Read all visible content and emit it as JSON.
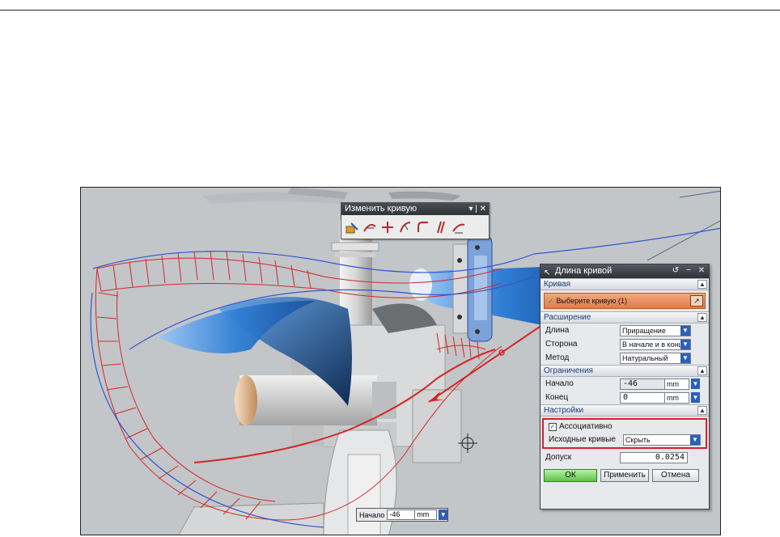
{
  "toolbar": {
    "title": "Изменить кривую",
    "icons": [
      "edit-curve-params-icon",
      "trim-curve-icon",
      "trim-corner-icon",
      "divide-curve-icon",
      "edit-fillet-icon",
      "stretch-curve-icon",
      "curve-length-icon",
      "smooth-spline-icon"
    ]
  },
  "dialog": {
    "title": "Длина кривой",
    "sections": {
      "curve": {
        "header": "Кривая",
        "select_label": "Выберите кривую (1)"
      },
      "extension": {
        "header": "Расширение",
        "length_label": "Длина",
        "length_value": "Приращение",
        "side_label": "Сторона",
        "side_value": "В начале и в конце",
        "method_label": "Метод",
        "method_value": "Натуральный"
      },
      "limits": {
        "header": "Ограничения",
        "start_label": "Начало",
        "start_value": "-46",
        "start_unit": "mm",
        "end_label": "Конец",
        "end_value": "0",
        "end_unit": "mm"
      },
      "settings": {
        "header": "Настройки",
        "associative_label": "Ассоциативно",
        "associative_checked": true,
        "source_curves_label": "Исходные кривые",
        "source_curves_value": "Скрыть",
        "tolerance_label": "Допуск",
        "tolerance_value": "0.0254"
      }
    },
    "buttons": {
      "ok": "ОК",
      "apply": "Применить",
      "cancel": "Отмена"
    }
  },
  "start_bubble": {
    "label": "Начало",
    "value": "-46",
    "unit": "mm"
  },
  "colors": {
    "viewport_bg": "#c2c6c9",
    "blade_blue": "#2f7fd6",
    "curve_red": "#d52626",
    "curve_blue": "#3355cc",
    "selection_orange": "#e07c4d",
    "highlight_red": "#d8202a"
  }
}
